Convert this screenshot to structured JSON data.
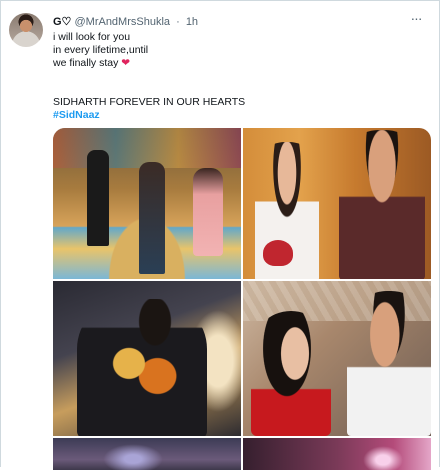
{
  "tweet": {
    "display_name": "G♡",
    "handle": "@MrAndMrsShukla",
    "separator": "·",
    "time": "1h",
    "more_icon": "ellipsis-icon",
    "lines": [
      "i will look for you",
      "in every lifetime,until",
      "we finally stay"
    ],
    "emoji": "❤",
    "tribute": "SIDHARTH FOREVER IN OUR HEARTS",
    "hashtag": "#SidNaaz"
  },
  "media": {
    "photo_count": 6
  }
}
